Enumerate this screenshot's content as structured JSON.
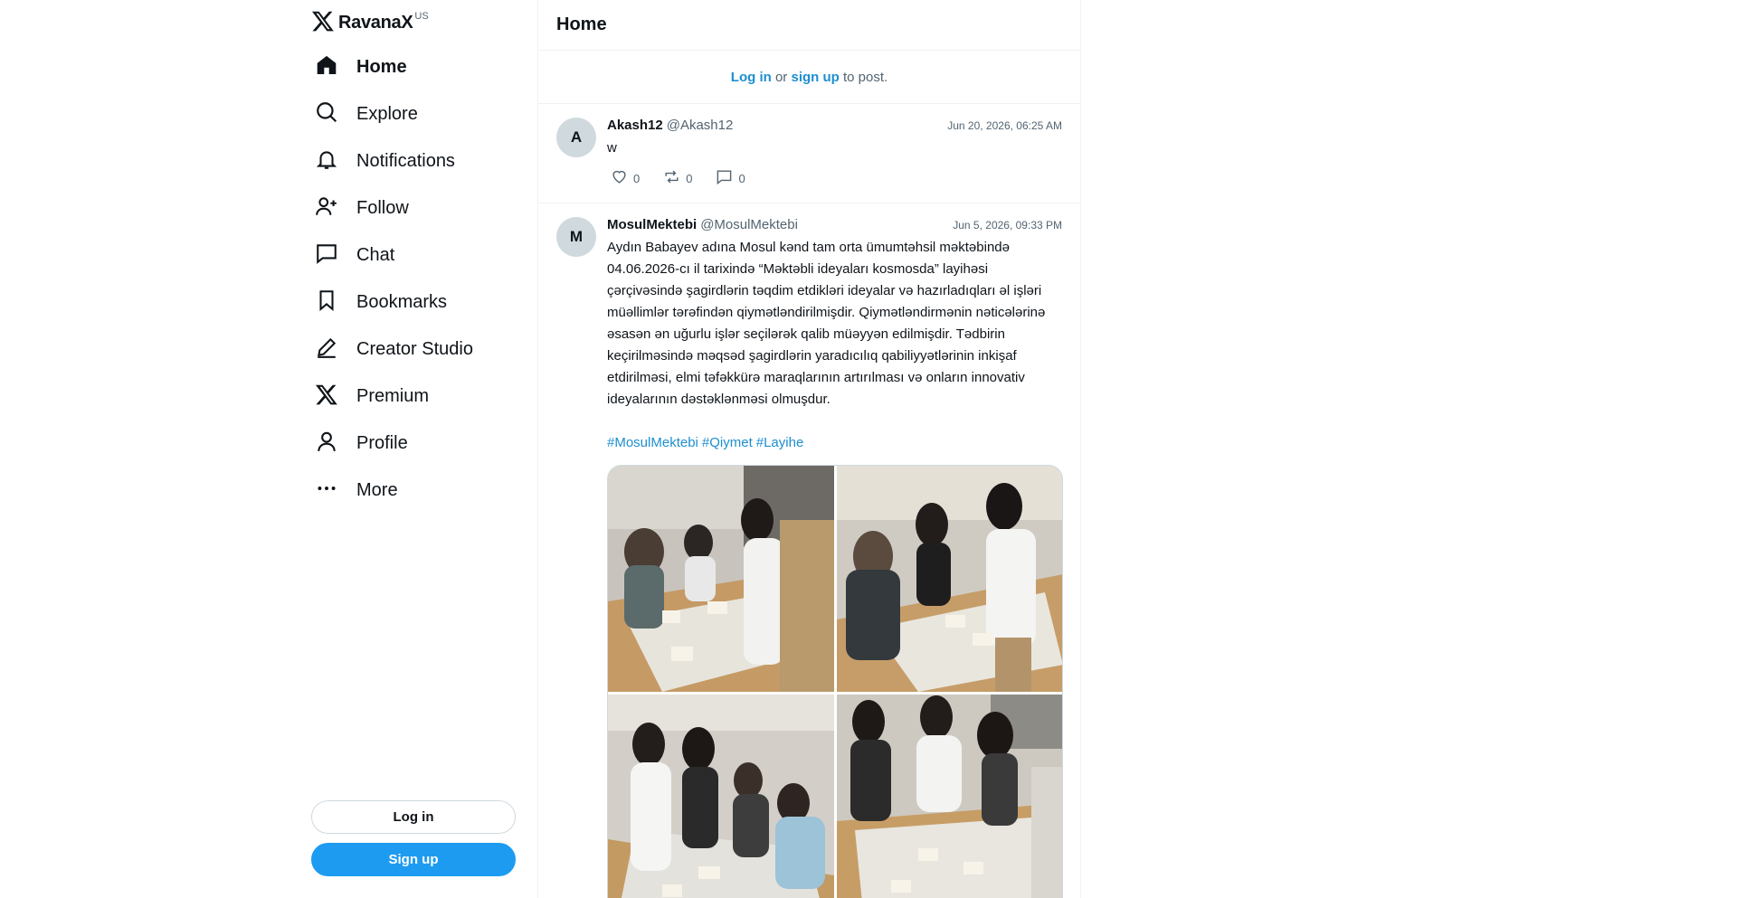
{
  "brand": {
    "name": "RavanaX",
    "superscript": "US",
    "logo_icon": "x-logo-icon"
  },
  "nav": [
    {
      "label": "Home",
      "icon": "home-icon",
      "active": true
    },
    {
      "label": "Explore",
      "icon": "search-icon"
    },
    {
      "label": "Notifications",
      "icon": "bell-icon"
    },
    {
      "label": "Follow",
      "icon": "person-add-icon"
    },
    {
      "label": "Chat",
      "icon": "chat-bubble-icon"
    },
    {
      "label": "Bookmarks",
      "icon": "bookmark-icon"
    },
    {
      "label": "Creator Studio",
      "icon": "pen-icon"
    },
    {
      "label": "Premium",
      "icon": "x-logo-icon"
    },
    {
      "label": "Profile",
      "icon": "person-icon"
    },
    {
      "label": "More",
      "icon": "more-dots-icon"
    }
  ],
  "auth": {
    "login_label": "Log in",
    "signup_label": "Sign up"
  },
  "header": {
    "title": "Home"
  },
  "loginbar": {
    "login": "Log in",
    "or": " or ",
    "signup": "sign up",
    "suffix": " to post."
  },
  "posts": [
    {
      "avatar_letter": "A",
      "author": "Akash12",
      "handle": "@Akash12",
      "date": "Jun 20, 2026, 06:25 AM",
      "text": "w",
      "likes": "0",
      "reposts": "0",
      "replies": "0"
    },
    {
      "avatar_letter": "M",
      "author": "MosulMektebi",
      "handle": "@MosulMektebi",
      "date": "Jun 5, 2026, 09:33 PM",
      "text": "Aydın Babayev adına Mosul kənd tam orta ümumtəhsil məktəbində 04.06.2026-cı il tarixində “Məktəbli ideyaları kosmosda” layihəsi çərçivəsində şagirdlərin təqdim etdikləri ideyalar və hazırladıqları əl işləri müəllimlər tərəfindən qiymətləndirilmişdir. Qiymətləndirmənin nəticələrinə əsasən ən uğurlu işlər seçilərək qalib müəyyən edilmişdir. Tədbirin keçirilməsində məqsəd şagirdlərin yaradıcılıq qabiliyyətlərinin inkişaf etdirilməsi, elmi təfəkkürə maraqlarının artırılması və onların innovativ ideyalarının dəstəklənməsi olmuşdur.",
      "tags": [
        "#MosulMektebi",
        "#Qiymet",
        "#Layihe"
      ]
    }
  ],
  "colors": {
    "accent": "#1d9bf0",
    "link": "#1d8fd0",
    "muted": "#536471",
    "border": "#eff3f4"
  }
}
